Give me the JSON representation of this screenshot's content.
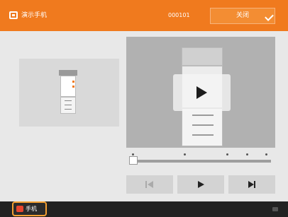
{
  "header": {
    "title": "演示手机",
    "code": "000101",
    "close_label": "关闭"
  },
  "player": {
    "progress": 0.0,
    "marker_positions": [
      0.0,
      0.37,
      0.68,
      0.82,
      0.96
    ]
  },
  "bottom": {
    "mobile_label": "手机"
  },
  "colors": {
    "accent": "#f07a1e",
    "highlight": "#f4a032",
    "bottom_bar": "#222222"
  }
}
